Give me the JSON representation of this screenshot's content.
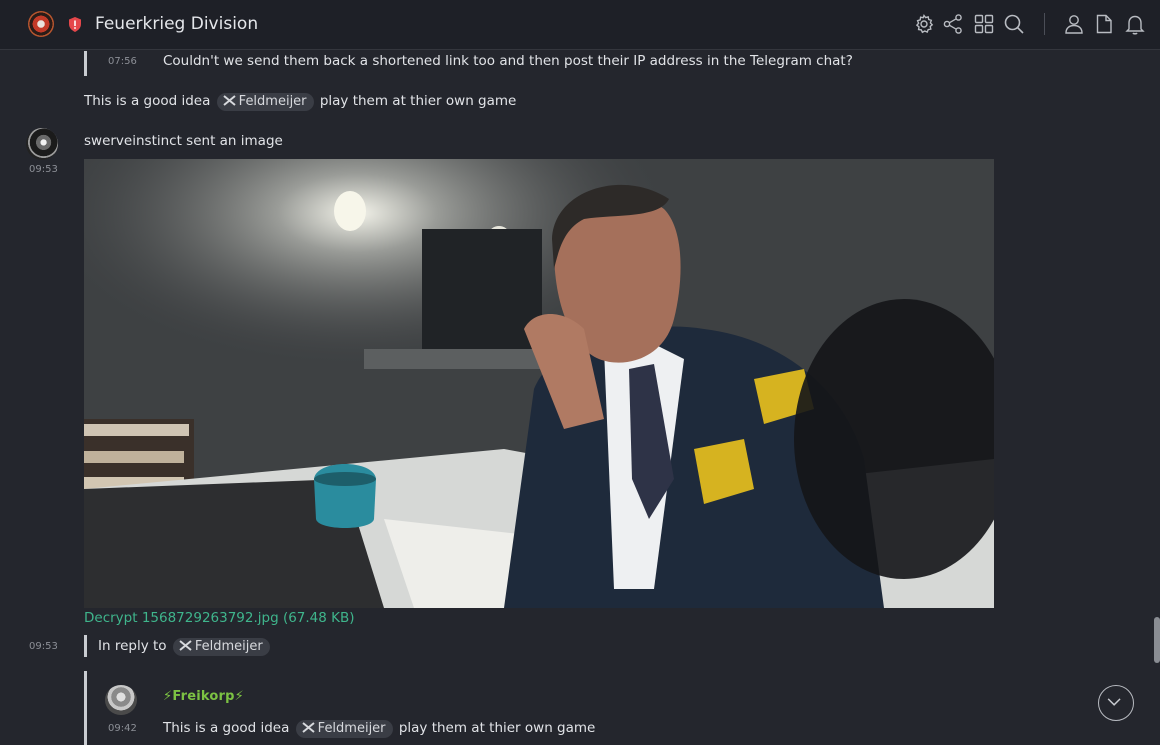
{
  "header": {
    "room_name": "Feuerkrieg Division",
    "icons": [
      "settings-icon",
      "share-icon",
      "apps-grid-icon",
      "search-icon",
      "user-icon",
      "file-icon",
      "bell-icon"
    ]
  },
  "messages": {
    "quoted_top": {
      "time": "07:56",
      "text": "Couldn't we send them back a shortened link too and then post their IP address in the Telegram chat?"
    },
    "reply_good_idea": {
      "before": "This is a good idea",
      "mention": "Feldmeijer",
      "after": "play them at thier own game"
    },
    "image_msg": {
      "time": "09:53",
      "sender_text": "swerveinstinct sent an image",
      "download_label": "Decrypt 1568729263792.jpg (67.48 KB)"
    },
    "in_reply": {
      "time": "09:53",
      "label": "In reply to",
      "mention": "Feldmeijer"
    },
    "quoted_bottom": {
      "sender": "⚡Freikorp⚡",
      "time": "09:42",
      "before": "This is a good idea",
      "mention": "Feldmeijer",
      "after": "play them at thier own game"
    }
  },
  "colors": {
    "background": "#24262d",
    "header": "#1e2027",
    "link": "#3fb58c",
    "mention_pill": "#3a3d45",
    "freikorp_green": "#7cc243"
  }
}
